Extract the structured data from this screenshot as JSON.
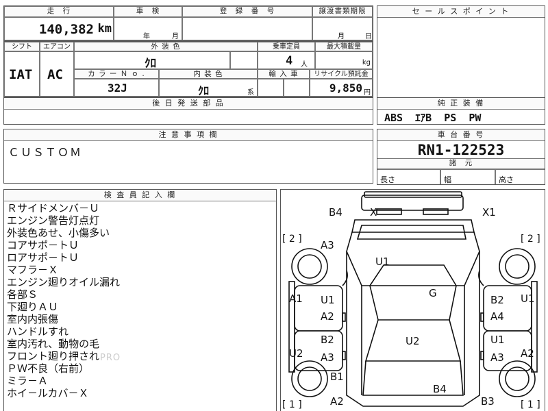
{
  "top_labels": {
    "mileage": "走　行",
    "inspection": "車　検",
    "registration_no": "登　録　番　号",
    "transfer_deadline": "譲渡書類期限",
    "sales_point": "セ ー ル ス ポ イ ン ト"
  },
  "mileage": {
    "value": "140,382",
    "unit": "km"
  },
  "inspection": {
    "year_unit": "年",
    "month_unit": "月"
  },
  "transfer": {
    "month_unit": "月",
    "day_unit": "日"
  },
  "spec_labels": {
    "shift": "シフト",
    "aircon": "エアコン",
    "exterior_color": "外 装 色",
    "capacity": "乗車定員",
    "max_load": "最大積載量",
    "color_no": "カ ラ ー Ｎ ｏ .",
    "interior_color": "内 装 色",
    "import": "輸 入 車",
    "recycle_fee": "リサイクル預託金",
    "deferred_parts": "後 日 発 送 部 品",
    "standard_equipment": "純 正 装 備"
  },
  "specs": {
    "shift": "IAT",
    "aircon": "AC",
    "exterior_color": "ｸﾛ",
    "capacity": "4",
    "capacity_unit": "人",
    "max_load_unit": "kg",
    "color_no": "32J",
    "interior_color": "ｸﾛ",
    "interior_suffix": "系",
    "recycle_fee": "9,850",
    "recycle_unit": "円",
    "equipment": "ABS  ｴｱB  PS  PW"
  },
  "caution": {
    "label": "注 意 事 項 欄",
    "text": "ＣＵＳＴＯＭ"
  },
  "chassis": {
    "label": "車 台 番 号",
    "number": "RN1-122523",
    "dims_label": "諸　元",
    "length": "長さ",
    "width": "幅",
    "height": "高さ"
  },
  "inspector": {
    "label": "検 査 員 記 入 欄",
    "notes": [
      "Ｒサイドメンバ－Ｕ",
      "エンジン警告灯点灯",
      "外装色あせ、小傷多い",
      "コアサポ－トＵ",
      "ロアサポ－トＵ",
      "マフラ－Ｘ",
      "エンジン廻りオイル漏れ",
      "各部Ｓ",
      "下廻りＡＵ",
      "室内内張傷",
      "ハンドルすれ",
      "室内汚れ、動物の毛",
      "フロント廻り押され",
      "ＰＷ不良（右前）",
      "ミラ－Ａ",
      "ホイ－ルカバ－Ｘ"
    ]
  },
  "diagram": {
    "watermark": "PRO",
    "marks": {
      "b4_top": "B4",
      "x_top": "X",
      "x1_top": "X1",
      "bracket_left_top": "[ 2 ]",
      "bracket_right_top": "[ 2 ]",
      "a3_hood": "A3",
      "u1_hood": "U1",
      "g_roof": "G",
      "a1_left": "A1",
      "u1_left_door": "U1",
      "a2_left_door": "A2",
      "b2_right_door": "B2",
      "a4_right_door": "A4",
      "u1_right": "U1",
      "b2_left_rear": "B2",
      "a3_left_rear": "A3",
      "u2_center": "U2",
      "u1_right_rear": "U1",
      "a3_right_rear": "A3",
      "u2_left": "U2",
      "a2_right": "A2",
      "b1_left": "B1",
      "b4_rear": "B4",
      "a2_bottom": "A2",
      "b3_bottom": "B3",
      "bracket_left_bottom": "[ 1 ]",
      "bracket_right_bottom": "[ 1 ]"
    }
  }
}
